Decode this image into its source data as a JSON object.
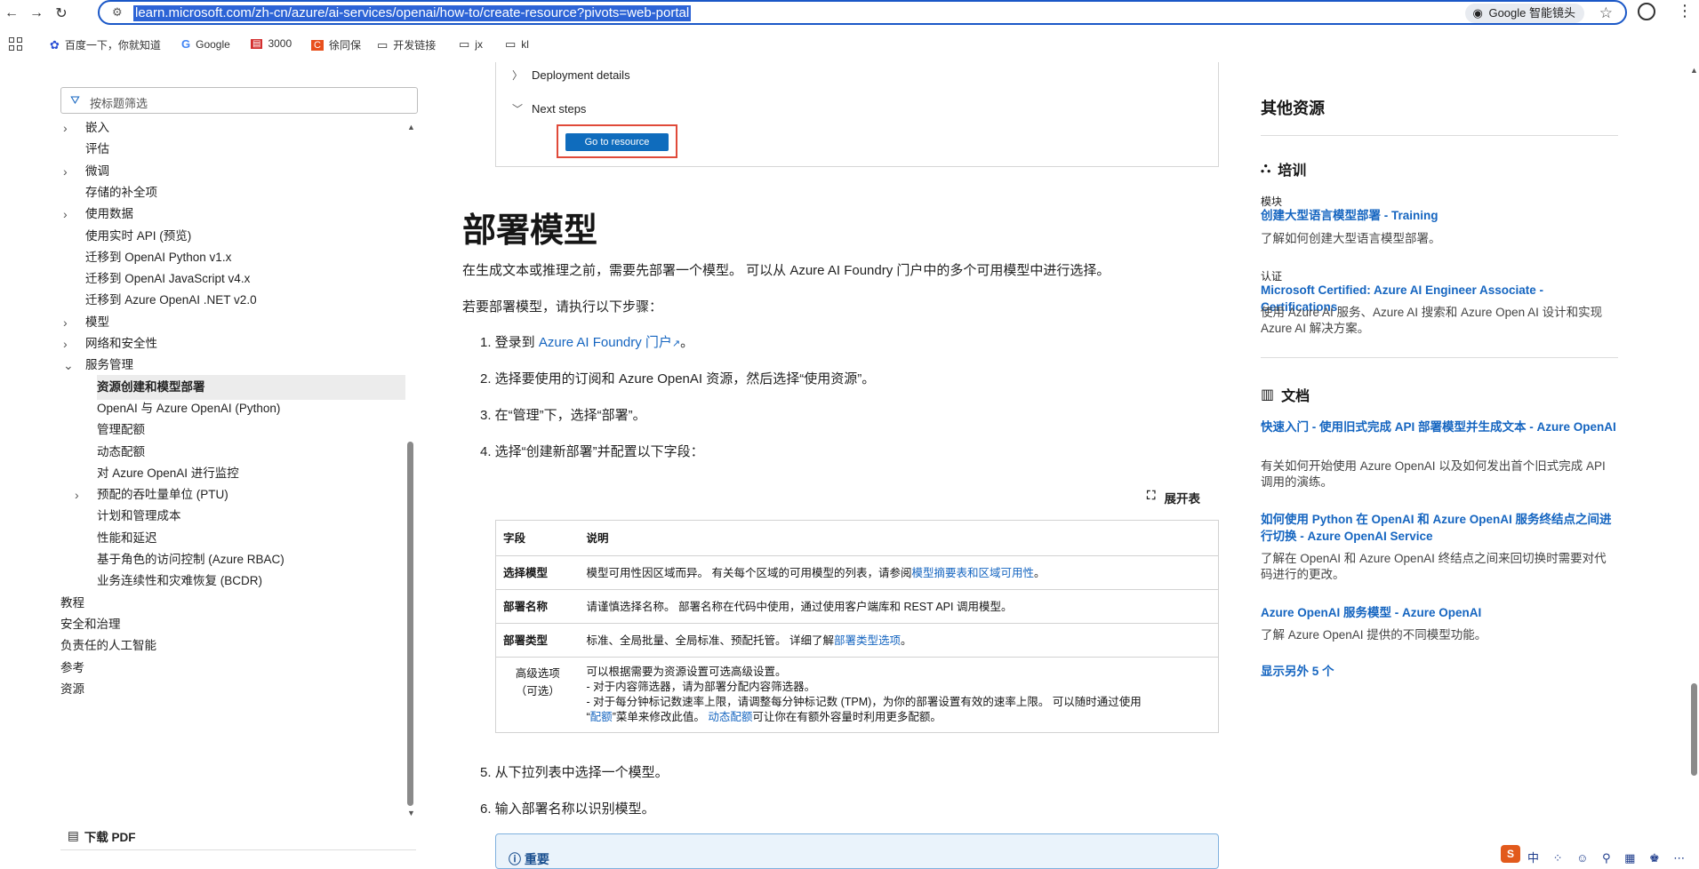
{
  "browser": {
    "url": "learn.microsoft.com/zh-cn/azure/ai-services/openai/how-to/create-resource?pivots=web-portal",
    "lens_label": "Google 智能镜头",
    "bookmarks": [
      "百度一下，你就知道",
      "Google",
      "3000",
      "徐同保",
      "开发链接",
      "jx",
      "kl"
    ]
  },
  "leftnav": {
    "filter_placeholder": "按标题筛选",
    "items": [
      {
        "label": "嵌入",
        "chev": true,
        "indent": 1
      },
      {
        "label": "评估",
        "chev": false,
        "indent": 1
      },
      {
        "label": "微调",
        "chev": true,
        "indent": 1
      },
      {
        "label": "存储的补全项",
        "chev": false,
        "indent": 1
      },
      {
        "label": "使用数据",
        "chev": true,
        "indent": 1
      },
      {
        "label": "使用实时 API (预览)",
        "chev": false,
        "indent": 1
      },
      {
        "label": "迁移到 OpenAI Python v1.x",
        "chev": false,
        "indent": 1
      },
      {
        "label": "迁移到 OpenAI JavaScript v4.x",
        "chev": false,
        "indent": 1
      },
      {
        "label": "迁移到 Azure OpenAI .NET v2.0",
        "chev": false,
        "indent": 1
      },
      {
        "label": "模型",
        "chev": true,
        "indent": 1
      },
      {
        "label": "网络和安全性",
        "chev": true,
        "indent": 1
      },
      {
        "label": "服务管理",
        "chev": "down",
        "indent": 1
      },
      {
        "label": "资源创建和模型部署",
        "chev": false,
        "indent": 2,
        "selected": true
      },
      {
        "label": "OpenAI 与 Azure OpenAI (Python)",
        "chev": false,
        "indent": 2
      },
      {
        "label": "管理配额",
        "chev": false,
        "indent": 2
      },
      {
        "label": "动态配额",
        "chev": false,
        "indent": 2
      },
      {
        "label": "对 Azure OpenAI 进行监控",
        "chev": false,
        "indent": 2
      },
      {
        "label": "预配的吞吐量单位 (PTU)",
        "chev": true,
        "indent": 2
      },
      {
        "label": "计划和管理成本",
        "chev": false,
        "indent": 2
      },
      {
        "label": "性能和延迟",
        "chev": false,
        "indent": 2
      },
      {
        "label": "基于角色的访问控制 (Azure RBAC)",
        "chev": false,
        "indent": 2
      },
      {
        "label": "业务连续性和灾难恢复 (BCDR)",
        "chev": false,
        "indent": 2
      },
      {
        "label": "教程",
        "chev": true,
        "indent": 0
      },
      {
        "label": "安全和治理",
        "chev": true,
        "indent": 0
      },
      {
        "label": "负责任的人工智能",
        "chev": true,
        "indent": 0
      },
      {
        "label": "参考",
        "chev": true,
        "indent": 0
      },
      {
        "label": "资源",
        "chev": true,
        "indent": 0
      }
    ],
    "download_pdf": "下载 PDF"
  },
  "main": {
    "acc_deployment": "Deployment details",
    "acc_next": "Next steps",
    "goto_button": "Go to resource",
    "heading": "部署模型",
    "intro": "在生成文本或推理之前，需要先部署一个模型。 可以从 Azure AI Foundry 门户中的多个可用模型中进行选择。",
    "steps_intro": "若要部署模型，请执行以下步骤：",
    "step1_prefix": "1. 登录到 ",
    "step1_link": "Azure AI Foundry 门户",
    "step1_suffix": "。",
    "step2": "2. 选择要使用的订阅和 Azure OpenAI 资源，然后选择“使用资源”。",
    "step3": "3. 在“管理”下，选择“部署”。",
    "step4": "4. 选择“创建新部署”并配置以下字段：",
    "expand_label": "展开表",
    "table": {
      "col1": "字段",
      "col2": "说明",
      "r1_k": "选择模型",
      "r1_v": "模型可用性因区域而异。 有关每个区域的可用模型的列表，请参阅",
      "r1_link": "模型摘要表和区域可用性",
      "r1_end": "。",
      "r2_k": "部署名称",
      "r2_v": "请谨慎选择名称。 部署名称在代码中使用，通过使用客户端库和 REST API 调用模型。",
      "r3_k": "部署类型",
      "r3_v": "标准、全局批量、全局标准、预配托管。 详细了解",
      "r3_link": "部署类型选项",
      "r3_end": "。",
      "r4_k1": "高级选项",
      "r4_k2": "（可选）",
      "r4_l1": "可以根据需要为资源设置可选高级设置。",
      "r4_l2": "- 对于内容筛选器，请为部署分配内容筛选器。",
      "r4_l3": "- 对于每分钟标记数速率上限，请调整每分钟标记数 (TPM)，为你的部署设置有效的速率上限。 可以随时通过使用",
      "r4_l4a": "“",
      "r4_l4_link": "配额",
      "r4_l4b": "”菜单来修改此值。 ",
      "r4_l4_link2": "动态配额",
      "r4_l4c": "可让你在有额外容量时利用更多配额。"
    },
    "step5": "5. 从下拉列表中选择一个模型。",
    "step6": "6. 输入部署名称以识别模型。",
    "important": "重要"
  },
  "right": {
    "title": "其他资源",
    "training_head": "培训",
    "t1_small": "模块",
    "t1_link": "创建大型语言模型部署 - Training",
    "t1_desc": "了解如何创建大型语言模型部署。",
    "t2_small": "认证",
    "t2_link": "Microsoft Certified: Azure AI Engineer Associate - Certifications",
    "t2_desc": "使用 Azure AI 服务、Azure AI 搜索和 Azure Open AI 设计和实现 Azure AI 解决方案。",
    "docs_head": "文档",
    "d1_link": "快速入门 - 使用旧式完成 API 部署模型并生成文本 - Azure OpenAI",
    "d1_desc": "有关如何开始使用 Azure OpenAI 以及如何发出首个旧式完成 API 调用的演练。",
    "d2_link": "如何使用 Python 在 OpenAI 和 Azure OpenAI 服务终结点之间进行切换 - Azure OpenAI Service",
    "d2_desc": "了解在 OpenAI 和 Azure OpenAI 终结点之间来回切换时需要对代码进行的更改。",
    "d3_link": "Azure OpenAI 服务模型 - Azure OpenAI",
    "d3_desc": "了解 Azure OpenAI 提供的不同模型功能。",
    "show_more": "显示另外 5 个"
  },
  "ime_label": "中"
}
